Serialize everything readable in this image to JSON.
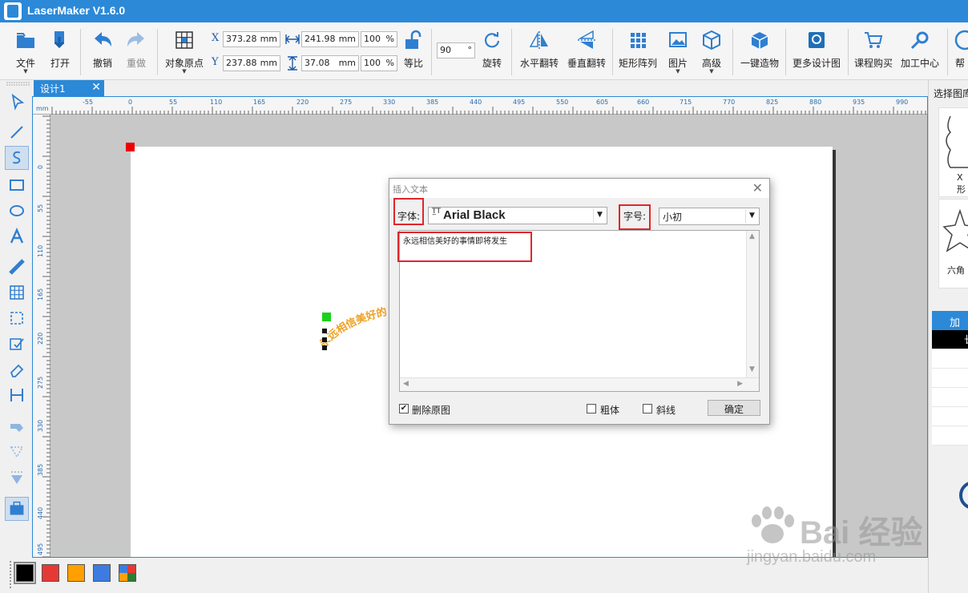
{
  "app": {
    "title": "LaserMaker V1.6.0"
  },
  "toolbar": {
    "file": "文件",
    "open": "打开",
    "undo": "撤销",
    "redo": "重做",
    "origin": "对象原点",
    "x_label": "X",
    "y_label": "Y",
    "x_value": "373.28",
    "y_value": "237.88",
    "width_value": "241.98",
    "height_value": "37.08",
    "unit": "mm",
    "width_pct": "100",
    "height_pct": "100",
    "pct_unit": "%",
    "ratio": "等比",
    "rotate_value": "90",
    "rotate_unit": "°",
    "rotate": "旋转",
    "hflip": "水平翻转",
    "vflip": "垂直翻转",
    "array": "矩形阵列",
    "image": "图片",
    "advanced": "高级",
    "one_click": "一键造物",
    "more_designs": "更多设计图",
    "courses": "课程购买",
    "processing": "加工中心",
    "help": "帮"
  },
  "tabs": [
    {
      "label": "设计1",
      "close": "✕"
    }
  ],
  "ruler": {
    "h_unit": "mm",
    "h_ticks": [
      "-55",
      "0",
      "55",
      "110",
      "165",
      "220",
      "275",
      "330",
      "385",
      "440",
      "495",
      "550",
      "605",
      "660",
      "715",
      "770",
      "825",
      "880",
      "935",
      "990"
    ],
    "v_ticks": [
      "0",
      "55",
      "110",
      "165",
      "220",
      "275",
      "330",
      "385",
      "440",
      "495"
    ]
  },
  "canvas": {
    "arc_text": "永远相信美好的"
  },
  "dialog": {
    "title": "插入文本",
    "close": "✕",
    "font_label": "字体:",
    "font_icon": "T̲T",
    "font_value": "Arial Black",
    "size_label": "字号:",
    "size_value": "小初",
    "text": "永远相信美好的事情即将发生",
    "delete_original": "删除原图",
    "delete_original_checked": "✔",
    "bold": "粗体",
    "italic": "斜线",
    "ok": "确定"
  },
  "right_panel": {
    "title": "选择图库",
    "item1_label": "X形",
    "item2_label": "六角",
    "process_tab": "加工",
    "row_label": "长"
  },
  "colors": {
    "accent": "#2b89d8",
    "highlight": "#e0262b",
    "swatches": [
      "#000000",
      "#e53935",
      "#ffa000",
      "#3d7be0",
      "multi"
    ]
  },
  "watermark": {
    "main": "Bai 经验",
    "sub": "jingyan.baidu.com"
  }
}
